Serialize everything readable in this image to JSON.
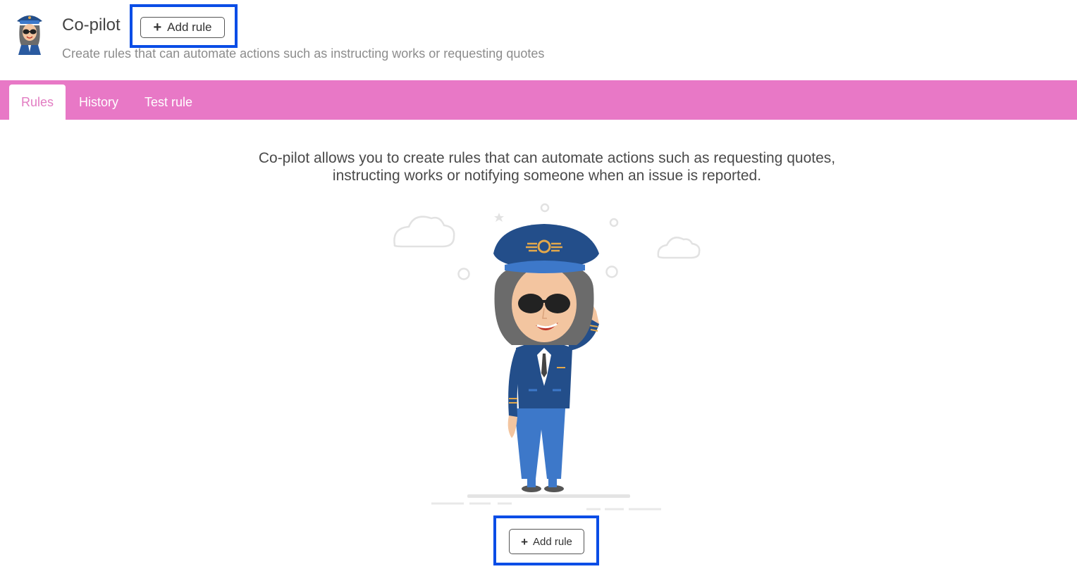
{
  "header": {
    "title": "Co-pilot",
    "subtitle": "Create rules that can automate actions such as instructing works or requesting quotes",
    "add_rule_label": "Add rule",
    "add_rule_icon": "plus-icon"
  },
  "tabs": [
    {
      "label": "Rules",
      "active": true
    },
    {
      "label": "History",
      "active": false
    },
    {
      "label": "Test rule",
      "active": false
    }
  ],
  "main": {
    "intro_line1": "Co-pilot allows you to create rules that can automate actions such as requesting quotes,",
    "intro_line2": "instructing works or notifying someone when an issue is reported.",
    "add_rule_label": "Add rule",
    "illustration": "pilot-saluting-illustration"
  },
  "colors": {
    "tab_bar": "#e878c6",
    "active_tab_text": "#e27cc2",
    "highlight_box": "#0a4de6",
    "uniform": "#2a5aa0"
  }
}
